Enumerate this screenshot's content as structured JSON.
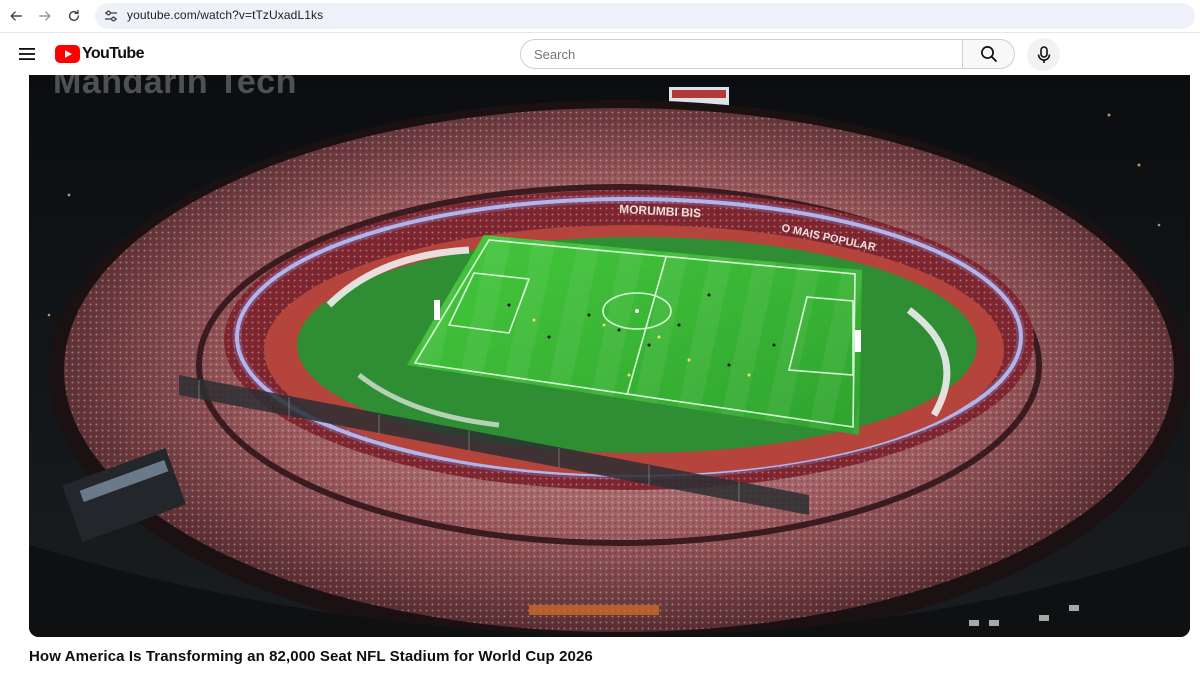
{
  "browser": {
    "url": "youtube.com/watch?v=tTzUxadL1ks"
  },
  "masthead": {
    "logo_text": "YouTube",
    "search_placeholder": "Search"
  },
  "video": {
    "watermark": "Mandarin Tech",
    "banners": [
      "MORUMBI BIS",
      "O MAIS POPULAR"
    ],
    "title": "How America Is Transforming an 82,000 Seat NFL Stadium for World Cup 2026"
  },
  "colors": {
    "youtube_red": "#ff0000",
    "pitch_green": "#3fbf3a",
    "track_red": "#b5453c",
    "crowd_red": "#8a2a2e"
  },
  "icons": {
    "back": "arrow-left-icon",
    "forward": "arrow-right-icon",
    "reload": "reload-icon",
    "site_info": "tune-icon",
    "menu": "hamburger-icon",
    "search": "search-icon",
    "mic": "microphone-icon"
  }
}
